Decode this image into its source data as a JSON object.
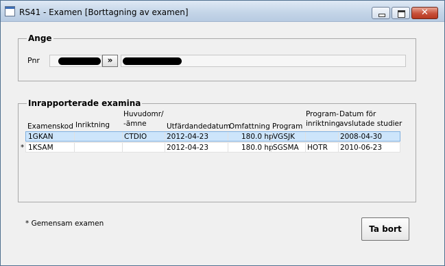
{
  "window": {
    "title": "RS41 - Examen [Borttagning av examen]"
  },
  "controls": {
    "close": "✕"
  },
  "ange": {
    "legend": "Ange",
    "pnr_label": "Pnr",
    "arrow_label": "»"
  },
  "examina": {
    "legend": "Inrapporterade examina",
    "headers": {
      "examenskod": "Examenskod",
      "inriktning": "Inriktning",
      "huvudomr_1": "Huvudomr/",
      "huvudomr_2": "-ämne",
      "utfardandedatum": "Utfärdandedatum",
      "omfattning": "Omfattning",
      "program": "Program",
      "prog_inr_1": "Program-",
      "prog_inr_2": "inriktning",
      "datum_1": "Datum för",
      "datum_2": "avslutade studier"
    },
    "rows": [
      {
        "marker": "",
        "examenskod": "1GKAN",
        "inriktning": "",
        "huvudomr": "CTDIO",
        "utfardandedatum": "2012-04-23",
        "omfattning": "180.0 hp",
        "program": "VGSJK",
        "programinriktning": "",
        "datum": "2008-04-30"
      },
      {
        "marker": "*",
        "examenskod": "1KSAM",
        "inriktning": "",
        "huvudomr": "",
        "utfardandedatum": "2012-04-23",
        "omfattning": "180.0 hp",
        "program": "SGSMA",
        "programinriktning": "HOTR",
        "datum": "2010-06-23"
      }
    ]
  },
  "footer": {
    "note": "* Gemensam examen",
    "delete_button": "Ta bort"
  }
}
